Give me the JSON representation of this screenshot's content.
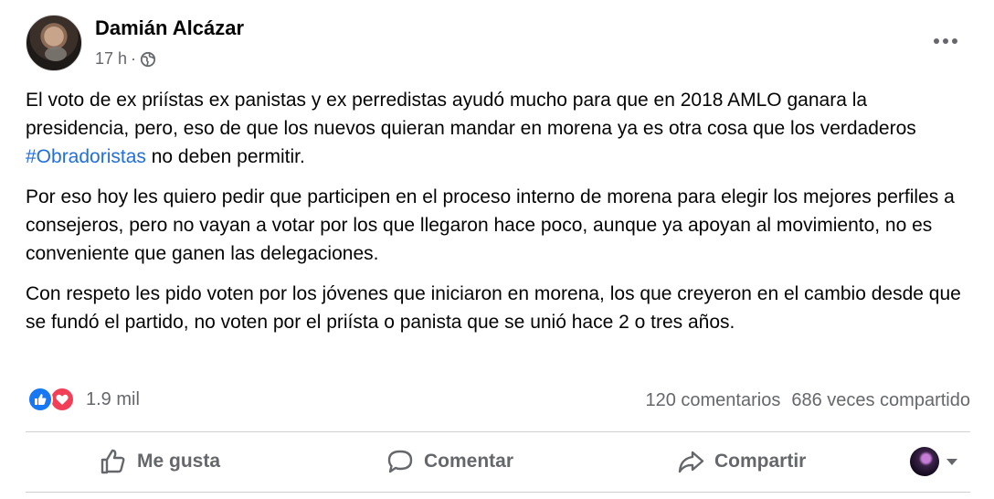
{
  "post": {
    "author": "Damián Alcázar",
    "time": "17 h",
    "separator": "·",
    "paragraphs": [
      {
        "before": "El voto de ex priístas ex panistas y ex perredistas ayudó mucho para que en 2018 AMLO ganara la presidencia, pero, eso de que los nuevos quieran mandar en morena ya es otra cosa que los verdaderos ",
        "hashtag": "#Obradoristas",
        "after": " no deben permitir."
      },
      {
        "text": "Por eso hoy les quiero pedir que participen en el proceso interno de morena para elegir los mejores perfiles a consejeros, pero no vayan a votar por los que llegaron hace poco, aunque ya apoyan al movimiento, no es conveniente que ganen las delegaciones."
      },
      {
        "text": "Con respeto les pido voten por los jóvenes que iniciaron en morena, los que creyeron en el cambio desde que se fundó el partido, no voten por el priísta o panista que se unió hace 2 o tres años."
      }
    ]
  },
  "engagement": {
    "reactions_count": "1.9 mil",
    "comments": "120 comentarios",
    "shares": "686 veces compartido"
  },
  "actions": {
    "like": "Me gusta",
    "comment": "Comentar",
    "share": "Compartir"
  },
  "icons": {
    "like": "like-icon",
    "love": "love-icon",
    "comment": "comment-icon",
    "share": "share-icon",
    "privacy": "globe-icon",
    "more": "more-options-icon"
  },
  "colors": {
    "like_blue": "#1877f2",
    "love_red": "#f33e58",
    "hashtag": "#216fdb",
    "muted": "#65676b"
  }
}
